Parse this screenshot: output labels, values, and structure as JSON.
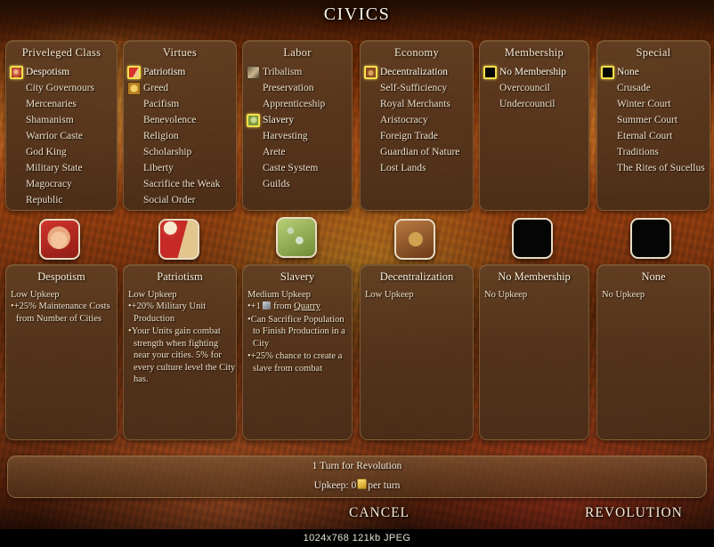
{
  "window": {
    "title": "CIVICS"
  },
  "categories": [
    {
      "id": "privileged-class",
      "title": "Priveleged Class",
      "options": [
        {
          "label": "Despotism",
          "icon": "fist-icon",
          "selected": true
        },
        {
          "label": "City Governours",
          "icon": "none",
          "selected": false
        },
        {
          "label": "Mercenaries",
          "icon": "none",
          "selected": false
        },
        {
          "label": "Shamanism",
          "icon": "none",
          "selected": false
        },
        {
          "label": "Warrior Caste",
          "icon": "none",
          "selected": false
        },
        {
          "label": "God King",
          "icon": "none",
          "selected": false
        },
        {
          "label": "Military State",
          "icon": "none",
          "selected": false
        },
        {
          "label": "Magocracy",
          "icon": "none",
          "selected": false
        },
        {
          "label": "Republic",
          "icon": "none",
          "selected": false
        }
      ]
    },
    {
      "id": "virtues",
      "title": "Virtues",
      "options": [
        {
          "label": "Patriotism",
          "icon": "banner-icon",
          "selected": true
        },
        {
          "label": "Greed",
          "icon": "gold-icon",
          "selected": false
        },
        {
          "label": "Pacifism",
          "icon": "none",
          "selected": false
        },
        {
          "label": "Benevolence",
          "icon": "none",
          "selected": false
        },
        {
          "label": "Religion",
          "icon": "none",
          "selected": false
        },
        {
          "label": "Scholarship",
          "icon": "none",
          "selected": false
        },
        {
          "label": "Liberty",
          "icon": "none",
          "selected": false
        },
        {
          "label": "Sacrifice the Weak",
          "icon": "none",
          "selected": false
        },
        {
          "label": "Social Order",
          "icon": "none",
          "selected": false
        }
      ]
    },
    {
      "id": "labor",
      "title": "Labor",
      "options": [
        {
          "label": "Tribalism",
          "icon": "tribe-icon",
          "selected": false
        },
        {
          "label": "Preservation",
          "icon": "none",
          "selected": false
        },
        {
          "label": "Apprenticeship",
          "icon": "none",
          "selected": false
        },
        {
          "label": "Slavery",
          "icon": "chain-icon",
          "selected": true
        },
        {
          "label": "Harvesting",
          "icon": "none",
          "selected": false
        },
        {
          "label": "Arete",
          "icon": "none",
          "selected": false
        },
        {
          "label": "Caste System",
          "icon": "none",
          "selected": false
        },
        {
          "label": "Guilds",
          "icon": "none",
          "selected": false
        }
      ]
    },
    {
      "id": "economy",
      "title": "Economy",
      "options": [
        {
          "label": "Decentralization",
          "icon": "coins-icon",
          "selected": true
        },
        {
          "label": "Self-Sufficiency",
          "icon": "none",
          "selected": false
        },
        {
          "label": "Royal Merchants",
          "icon": "none",
          "selected": false
        },
        {
          "label": "Aristocracy",
          "icon": "none",
          "selected": false
        },
        {
          "label": "Foreign Trade",
          "icon": "none",
          "selected": false
        },
        {
          "label": "Guardian of Nature",
          "icon": "none",
          "selected": false
        },
        {
          "label": "Lost Lands",
          "icon": "none",
          "selected": false
        }
      ]
    },
    {
      "id": "membership",
      "title": "Membership",
      "options": [
        {
          "label": "No Membership",
          "icon": "black-icon",
          "selected": true
        },
        {
          "label": "Overcouncil",
          "icon": "none",
          "selected": false
        },
        {
          "label": "Undercouncil",
          "icon": "none",
          "selected": false
        }
      ]
    },
    {
      "id": "special",
      "title": "Special",
      "options": [
        {
          "label": "None",
          "icon": "black-icon",
          "selected": true
        },
        {
          "label": "Crusade",
          "icon": "none",
          "selected": false
        },
        {
          "label": "Winter Court",
          "icon": "none",
          "selected": false
        },
        {
          "label": "Summer Court",
          "icon": "none",
          "selected": false
        },
        {
          "label": "Eternal Court",
          "icon": "none",
          "selected": false
        },
        {
          "label": "Traditions",
          "icon": "none",
          "selected": false
        },
        {
          "label": "The Rites of Sucellus",
          "icon": "none",
          "selected": false
        }
      ]
    }
  ],
  "details": [
    {
      "id": "despotism",
      "icon": "fist-icon",
      "title": "Despotism",
      "upkeep": "Low Upkeep",
      "effects": [
        "+25% Maintenance Costs from Number of Cities"
      ]
    },
    {
      "id": "patriotism",
      "icon": "banner-icon",
      "title": "Patriotism",
      "upkeep": "Low Upkeep",
      "effects": [
        "+20% Military Unit Production",
        "Your Units gain combat strength when fighting near your cities. 5% for every culture level the City has."
      ]
    },
    {
      "id": "slavery",
      "icon": "chain-icon",
      "title": "Slavery",
      "upkeep": "Medium Upkeep",
      "effects": [
        "+1 [hammer] from Quarry",
        "Can Sacrifice Population to Finish Production in a City",
        "+25% chance to create a slave from combat"
      ],
      "link_text": "Quarry"
    },
    {
      "id": "decentralization",
      "icon": "coins-icon",
      "title": "Decentralization",
      "upkeep": "Low Upkeep",
      "effects": []
    },
    {
      "id": "no-membership",
      "icon": "black-icon",
      "title": "No Membership",
      "upkeep": "No Upkeep",
      "effects": []
    },
    {
      "id": "none-special",
      "icon": "black-icon",
      "title": "None",
      "upkeep": "No Upkeep",
      "effects": []
    }
  ],
  "status": {
    "turns_line": "1 Turn for Revolution",
    "upkeep_prefix": "Upkeep: 0",
    "upkeep_suffix": "per turn",
    "upkeep_value": "0",
    "coin_icon": "gold-coin-icon"
  },
  "actions": {
    "cancel_label": "CANCEL",
    "revolution_label": "REVOLUTION"
  },
  "footer": {
    "meta": "1024x768  121kb  JPEG"
  },
  "colors": {
    "panel_bg": "#533420",
    "panel_border": "#a07646",
    "selection_highlight": "#f6e04a",
    "text": "#efe1cb",
    "title_text": "#fdf4e4"
  }
}
